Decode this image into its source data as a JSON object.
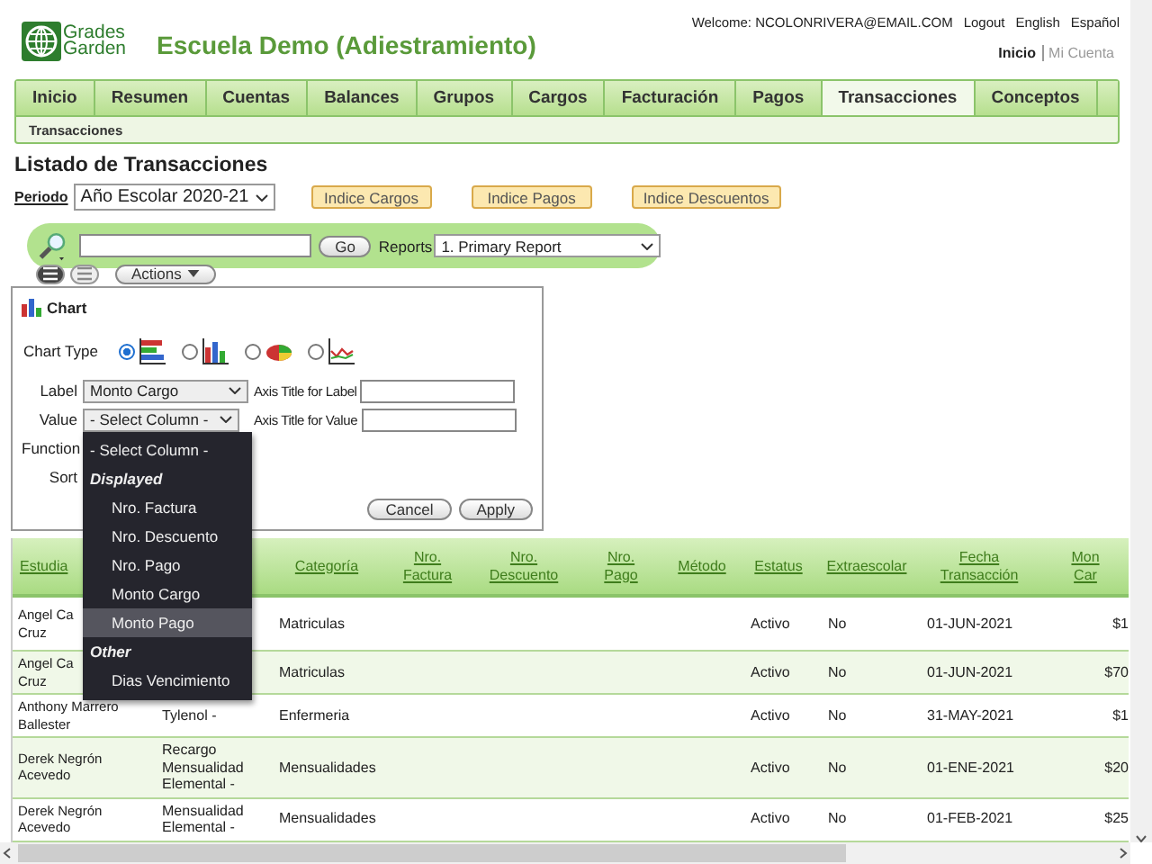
{
  "header": {
    "logo_text": [
      "Grades",
      "Garden"
    ],
    "school_title": "Escuela Demo (Adiestramiento)",
    "welcome": "Welcome: NCOLONRIVERA@EMAIL.COM",
    "links": [
      "Logout",
      "English",
      "Español"
    ],
    "account_links": [
      {
        "label": "Inicio",
        "selected": true
      },
      {
        "label": "Mi Cuenta",
        "selected": false
      }
    ]
  },
  "tabs": [
    {
      "label": "Inicio",
      "selected": false
    },
    {
      "label": "Resumen",
      "selected": false
    },
    {
      "label": "Cuentas",
      "selected": false
    },
    {
      "label": "Balances",
      "selected": false
    },
    {
      "label": "Grupos",
      "selected": false
    },
    {
      "label": "Cargos",
      "selected": false
    },
    {
      "label": "Facturación",
      "selected": false
    },
    {
      "label": "Pagos",
      "selected": false
    },
    {
      "label": "Transacciones",
      "selected": true
    },
    {
      "label": "Conceptos",
      "selected": false
    }
  ],
  "subnav": [
    "Transacciones"
  ],
  "page_title": "Listado de Transacciones",
  "period": {
    "label": "Periodo",
    "value": "Año Escolar 2020-21"
  },
  "index_buttons": [
    "Indice Cargos",
    "Indice Pagos",
    "Indice Descuentos"
  ],
  "search": {
    "go": "Go",
    "reports_label": "Reports",
    "report_value": "1. Primary Report"
  },
  "view_toggles": [
    {
      "selected": true
    },
    {
      "selected": false
    }
  ],
  "actions": "Actions",
  "chart_panel": {
    "title": "Chart",
    "type_label": "Chart Type",
    "chart_types": [
      {
        "kind": "hbar",
        "selected": true
      },
      {
        "kind": "bar",
        "selected": false
      },
      {
        "kind": "pie",
        "selected": false
      },
      {
        "kind": "line",
        "selected": false
      }
    ],
    "label_field": {
      "label": "Label",
      "value": "Monto Cargo"
    },
    "label_axis": "Axis Title for Label",
    "value_field": {
      "label": "Value",
      "value": "- Select Column -"
    },
    "value_axis": "Axis Title for Value",
    "function_label": "Function",
    "sort_label": "Sort",
    "buttons": [
      "Cancel",
      "Apply"
    ]
  },
  "dropdown": [
    {
      "kind": "option",
      "label": "- Select Column -",
      "selected": false,
      "indent": false
    },
    {
      "kind": "group",
      "label": "Displayed"
    },
    {
      "kind": "option",
      "label": "Nro. Factura",
      "selected": false,
      "indent": true
    },
    {
      "kind": "option",
      "label": "Nro. Descuento",
      "selected": false,
      "indent": true
    },
    {
      "kind": "option",
      "label": "Nro. Pago",
      "selected": false,
      "indent": true
    },
    {
      "kind": "option",
      "label": "Monto Cargo",
      "selected": false,
      "indent": true
    },
    {
      "kind": "option",
      "label": "Monto Pago",
      "selected": true,
      "indent": true
    },
    {
      "kind": "group",
      "label": "Other"
    },
    {
      "kind": "option",
      "label": "Dias Vencimiento",
      "selected": false,
      "indent": true
    }
  ],
  "table": {
    "columns": [
      {
        "label": "Estudia"
      },
      {},
      {
        "label": "Categoría"
      },
      {
        "label": "Nro.\nFactura"
      },
      {
        "label": "Nro.\nDescuento"
      },
      {
        "label": "Nro.\nPago"
      },
      {
        "label": "Método"
      },
      {
        "label": "Estatus"
      },
      {
        "label": "Extraescolar"
      },
      {
        "label": "Fecha\nTransacción"
      },
      {
        "label": "Mon\nCar"
      }
    ],
    "rows": [
      [
        "Angel Ca\nCruz",
        null,
        "Matriculas",
        null,
        null,
        null,
        null,
        "Activo",
        "No",
        "01-JUN-2021",
        "$1"
      ],
      [
        "Angel Ca\nCruz",
        null,
        "Matriculas",
        null,
        null,
        null,
        null,
        "Activo",
        "No",
        "01-JUN-2021",
        "$70"
      ],
      [
        "Anthony Marrero\nBallester",
        "Tylenol -",
        "Enfermeria",
        null,
        null,
        null,
        null,
        "Activo",
        "No",
        "31-MAY-2021",
        "$1"
      ],
      [
        "Derek Negrón\nAcevedo",
        "Recargo\nMensualidad\nElemental -",
        "Mensualidades",
        null,
        null,
        null,
        null,
        "Activo",
        "No",
        "01-ENE-2021",
        "$20"
      ],
      [
        "Derek Negrón\nAcevedo",
        "Mensualidad\nElemental -",
        "Mensualidades",
        null,
        null,
        null,
        null,
        "Activo",
        "No",
        "01-FEB-2021",
        "$25"
      ]
    ]
  }
}
